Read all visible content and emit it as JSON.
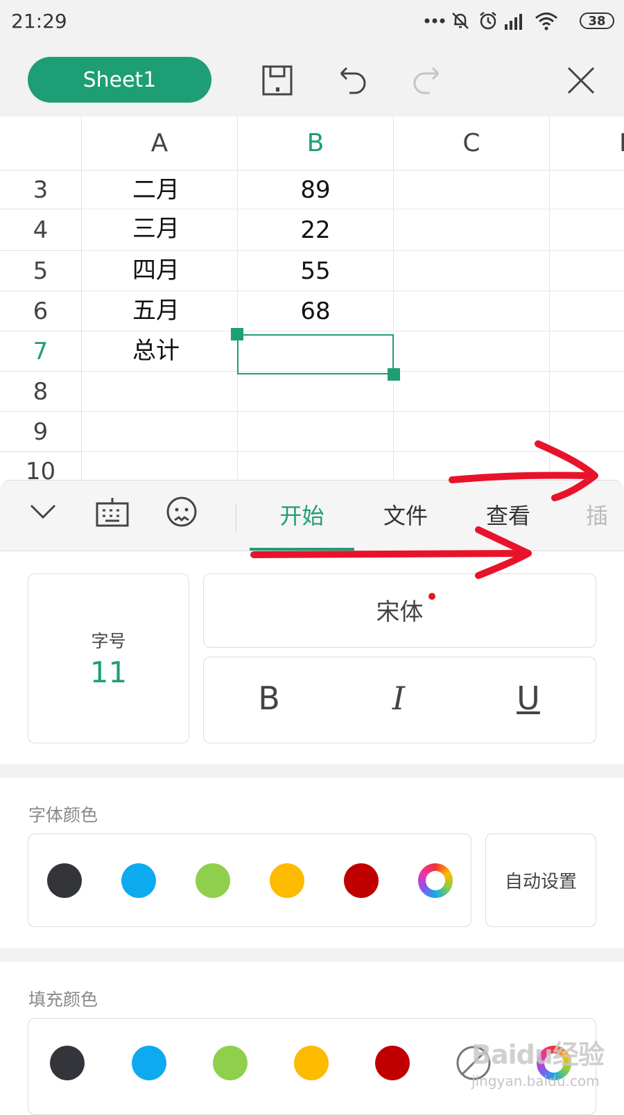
{
  "status_bar": {
    "time": "21:29",
    "battery": "38"
  },
  "toolbar": {
    "sheet_tab": "Sheet1"
  },
  "grid": {
    "columns": [
      "A",
      "B",
      "C",
      "D"
    ],
    "rows": [
      {
        "num": "3",
        "a": "二月",
        "b": "89"
      },
      {
        "num": "4",
        "a": "三月",
        "b": "22"
      },
      {
        "num": "5",
        "a": "四月",
        "b": "55"
      },
      {
        "num": "6",
        "a": "五月",
        "b": "68"
      },
      {
        "num": "7",
        "a": "总计",
        "b": ""
      },
      {
        "num": "8",
        "a": "",
        "b": ""
      },
      {
        "num": "9",
        "a": "",
        "b": ""
      },
      {
        "num": "10",
        "a": "",
        "b": ""
      }
    ],
    "selected_cell": "B7"
  },
  "ribbon": {
    "tabs": [
      "开始",
      "文件",
      "查看",
      "插"
    ],
    "active_tab": "开始"
  },
  "format": {
    "font_size_label": "字号",
    "font_size_value": "11",
    "font_name": "宋体",
    "bold": "B",
    "italic": "I",
    "underline": "U",
    "font_color_title": "字体颜色",
    "fill_color_title": "填充颜色",
    "auto_label": "自动设置",
    "colors": [
      "#33353a",
      "#0eaaef",
      "#8fcf4c",
      "#fdbb00",
      "#c00000"
    ]
  },
  "accent_color": "#1e9e74",
  "annotation_color": "#e8132b",
  "watermark": {
    "brand": "Baidu经验",
    "domain": "jingyan.baidu.com"
  }
}
